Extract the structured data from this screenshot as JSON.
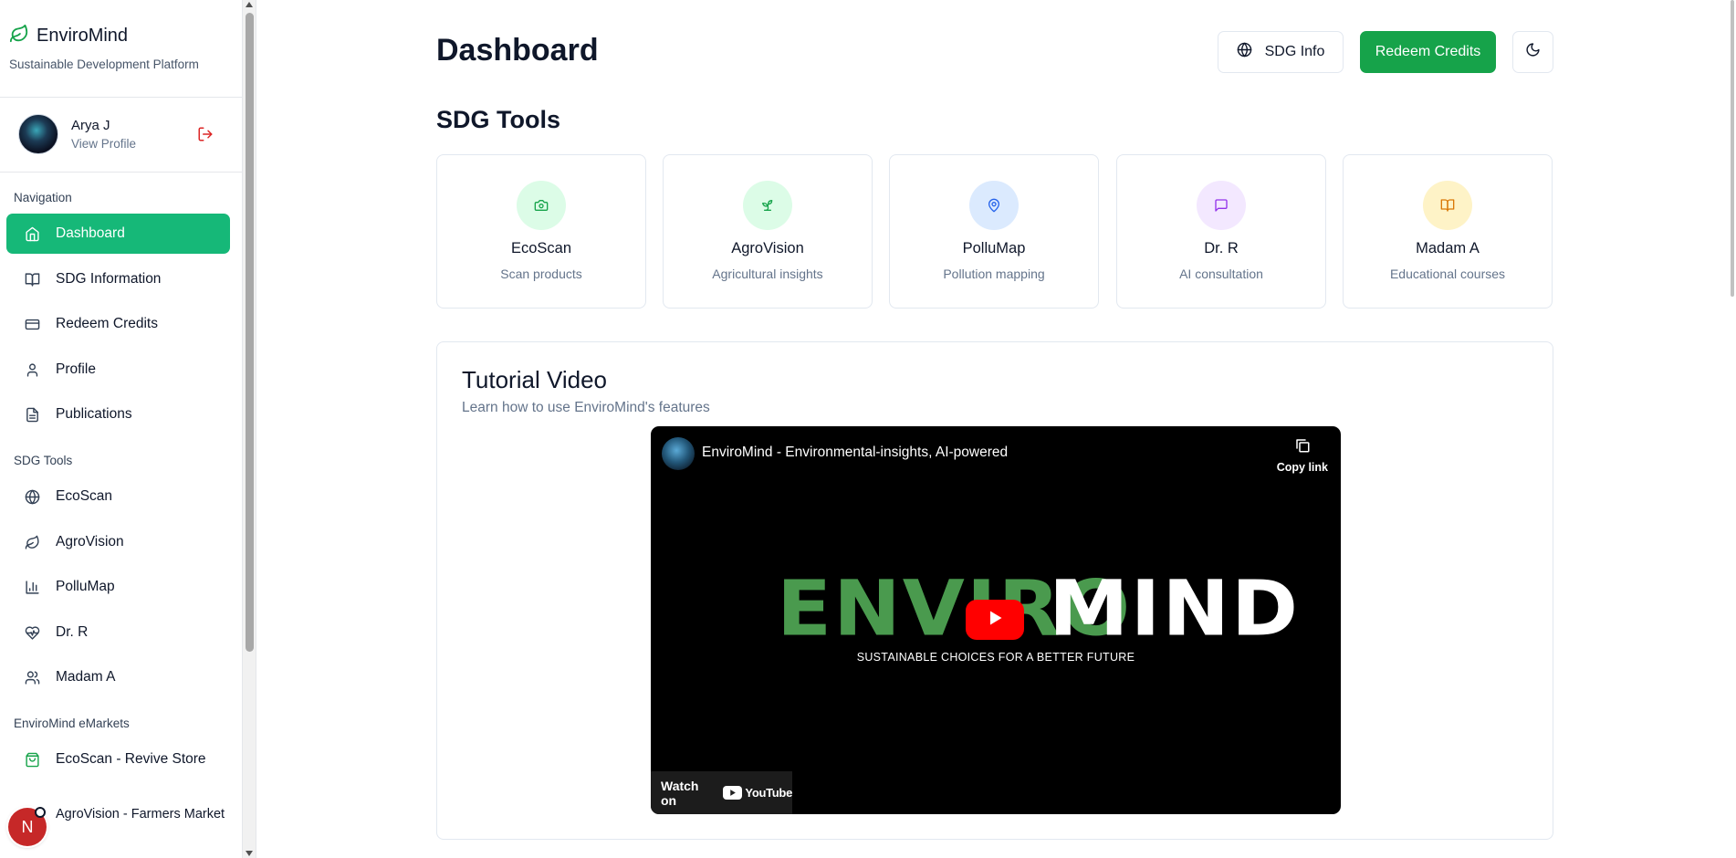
{
  "brand": {
    "name": "EnviroMind",
    "subtitle": "Sustainable Development Platform",
    "icon": "leaf-icon",
    "color": "#16a34a"
  },
  "user": {
    "name": "Arya J",
    "link": "View Profile",
    "logout_icon": "logout-icon"
  },
  "sidebar": {
    "navigation_label": "Navigation",
    "navigation": [
      {
        "label": "Dashboard",
        "icon": "home-icon",
        "active": true
      },
      {
        "label": "SDG Information",
        "icon": "book-icon"
      },
      {
        "label": "Redeem Credits",
        "icon": "credit-card-icon"
      },
      {
        "label": "Profile",
        "icon": "user-icon"
      },
      {
        "label": "Publications",
        "icon": "file-text-icon"
      }
    ],
    "tools_label": "SDG Tools",
    "tools": [
      {
        "label": "EcoScan",
        "icon": "globe-icon"
      },
      {
        "label": "AgroVision",
        "icon": "leaf-icon"
      },
      {
        "label": "PolluMap",
        "icon": "bar-chart-icon"
      },
      {
        "label": "Dr. R",
        "icon": "heart-pulse-icon"
      },
      {
        "label": "Madam A",
        "icon": "users-icon"
      }
    ],
    "emarkets_label": "EnviroMind eMarkets",
    "emarkets": [
      {
        "label": "EcoScan - Revive Store",
        "icon": "shopping-bag-icon"
      },
      {
        "label": "AgroVision - Farmers Market",
        "icon": "store-icon"
      }
    ],
    "fab_letter": "N"
  },
  "header": {
    "title": "Dashboard",
    "sdg_info_label": "SDG Info",
    "redeem_label": "Redeem Credits",
    "theme_icon": "moon-icon",
    "accent": "#16a34a"
  },
  "tools_section": {
    "title": "SDG Tools",
    "cards": [
      {
        "name": "EcoScan",
        "desc": "Scan products",
        "icon": "camera-icon",
        "bg": "#dcfce7",
        "fg": "#16a34a"
      },
      {
        "name": "AgroVision",
        "desc": "Agricultural insights",
        "icon": "sprout-icon",
        "bg": "#dcfce7",
        "fg": "#16a34a"
      },
      {
        "name": "PolluMap",
        "desc": "Pollution mapping",
        "icon": "map-pin-icon",
        "bg": "#dbeafe",
        "fg": "#2563eb"
      },
      {
        "name": "Dr. R",
        "desc": "AI consultation",
        "icon": "message-square-icon",
        "bg": "#f3e8ff",
        "fg": "#9333ea"
      },
      {
        "name": "Madam A",
        "desc": "Educational courses",
        "icon": "book-open-icon",
        "bg": "#fef3c7",
        "fg": "#d97706"
      }
    ]
  },
  "video": {
    "title": "Tutorial Video",
    "subtitle": "Learn how to use EnviroMind's features",
    "player_title": "EnviroMind - Environmental-insights, AI-powered",
    "copy_link": "Copy link",
    "logo_part1": "ENVIRO",
    "logo_part2": "MIND",
    "tagline": "SUSTAINABLE CHOICES FOR A BETTER FUTURE",
    "watch_on": "Watch on",
    "youtube": "YouTube"
  }
}
